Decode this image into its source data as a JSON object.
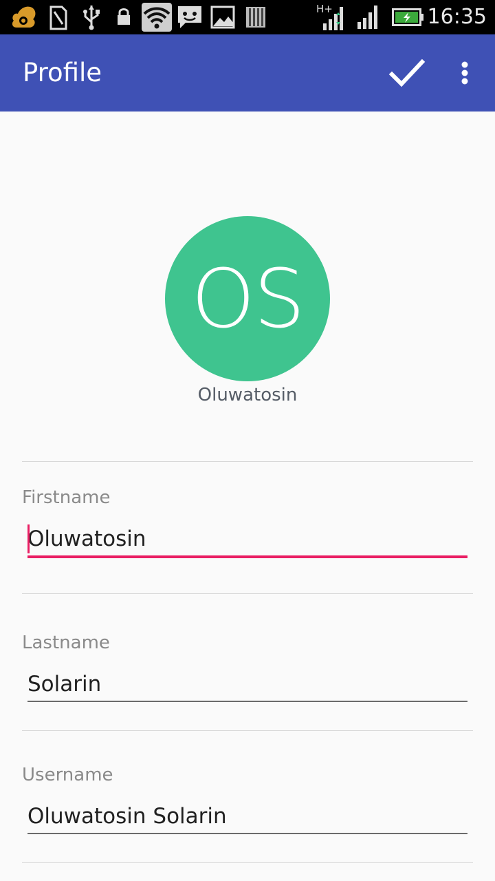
{
  "status_bar": {
    "time": "16:35",
    "icons": [
      "uc-browser-icon",
      "sim-card-icon",
      "usb-icon",
      "lock-icon",
      "wifi-icon",
      "chat-icon",
      "image-icon",
      "barcode-icon",
      "signal-h-plus-icon",
      "signal-icon",
      "battery-charging-icon"
    ],
    "network_label": "H+"
  },
  "app_bar": {
    "title": "Profile",
    "confirm_icon": "check-icon",
    "menu_icon": "more-vert-icon",
    "color": "#3f51b5"
  },
  "profile": {
    "initials": "OS",
    "display_name": "Oluwatosin",
    "avatar_color": "#3fc48f"
  },
  "form": {
    "firstname": {
      "label": "Firstname",
      "value": "Oluwatosin",
      "focused": true
    },
    "lastname": {
      "label": "Lastname",
      "value": "Solarin"
    },
    "username": {
      "label": "Username",
      "value": "Oluwatosin Solarin"
    }
  },
  "accent_color": "#e91e63"
}
